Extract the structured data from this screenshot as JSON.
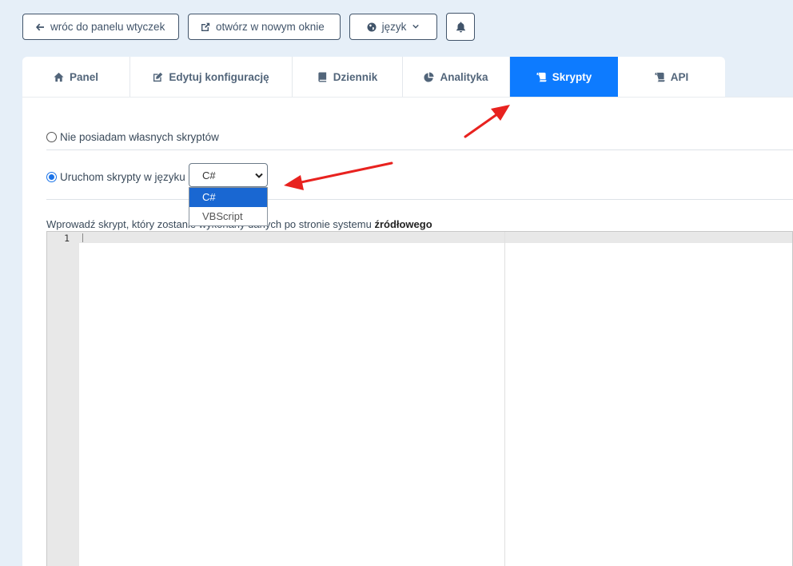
{
  "topbar": {
    "back_label": "wróc do panelu wtyczek",
    "open_label": "otwórz w nowym oknie",
    "lang_label": "język"
  },
  "tabs": [
    {
      "label": "Panel",
      "icon": "home-icon"
    },
    {
      "label": "Edytuj konfigurację",
      "icon": "edit-icon"
    },
    {
      "label": "Dziennik",
      "icon": "book-icon"
    },
    {
      "label": "Analityka",
      "icon": "pie-chart-icon"
    },
    {
      "label": "Skrypty",
      "icon": "scroll-icon",
      "active": true
    },
    {
      "label": "API",
      "icon": "scroll-icon"
    }
  ],
  "scripts": {
    "option_none": "Nie posiadam własnych skryptów",
    "option_run": "Uruchom skrypty w języku",
    "language_selected": "C#",
    "language_options": [
      "C#",
      "VBScript"
    ],
    "hint_prefix": "Wprowadź skrypt, który zostanie wykonany",
    "hint_suffix": "danych po stronie systemu",
    "hint_bold": "źródłowego"
  },
  "editor": {
    "line_number": "1"
  },
  "colors": {
    "accent": "#0d7bff",
    "background": "#e6eff8",
    "arrow": "#e8221f"
  }
}
